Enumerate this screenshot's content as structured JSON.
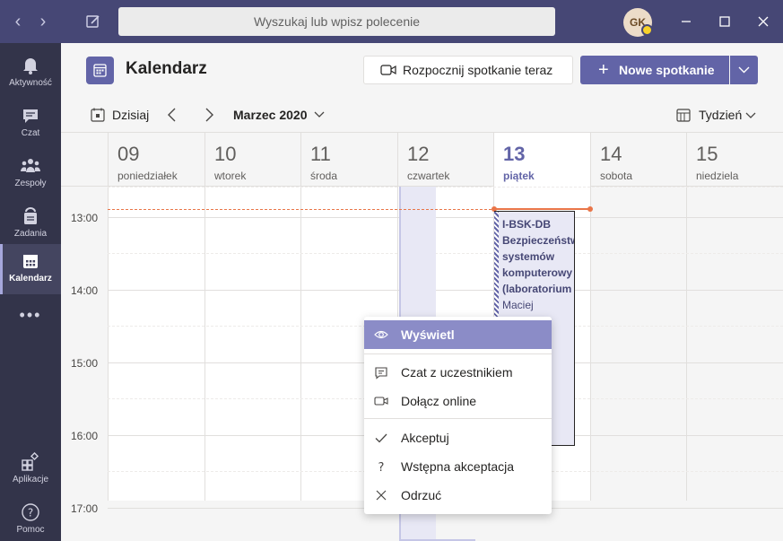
{
  "titlebar": {
    "search_placeholder": "Wyszukaj lub wpisz polecenie",
    "avatar_initials": "GK"
  },
  "rail": {
    "items": [
      {
        "label": "Aktywność",
        "icon": "bell-icon"
      },
      {
        "label": "Czat",
        "icon": "chat-icon"
      },
      {
        "label": "Zespoły",
        "icon": "teams-icon"
      },
      {
        "label": "Zadania",
        "icon": "assignments-icon"
      },
      {
        "label": "Kalendarz",
        "icon": "calendar-icon"
      },
      {
        "label": "Aplikacje",
        "icon": "apps-icon"
      },
      {
        "label": "Pomoc",
        "icon": "help-icon"
      }
    ],
    "more": "•••"
  },
  "header": {
    "title": "Kalendarz",
    "meet_now": "Rozpocznij spotkanie teraz",
    "new_meeting": "Nowe spotkanie"
  },
  "toolbar": {
    "today": "Dzisiaj",
    "month": "Marzec 2020",
    "view": "Tydzień"
  },
  "days": [
    {
      "num": "09",
      "name": "poniedziałek"
    },
    {
      "num": "10",
      "name": "wtorek"
    },
    {
      "num": "11",
      "name": "środa"
    },
    {
      "num": "12",
      "name": "czwartek"
    },
    {
      "num": "13",
      "name": "piątek"
    },
    {
      "num": "14",
      "name": "sobota"
    },
    {
      "num": "15",
      "name": "niedziela"
    }
  ],
  "times": [
    "13:00",
    "14:00",
    "15:00",
    "16:00",
    "17:00"
  ],
  "event": {
    "lines": [
      "I-BSK-DB",
      "Bezpieczeństw",
      "systemów",
      "komputerowy",
      "(laboratorium"
    ],
    "organizer": "Maciej"
  },
  "context_menu": {
    "items": [
      {
        "label": "Wyświetl",
        "icon": "eye-icon"
      },
      {
        "label": "Czat z uczestnikiem",
        "icon": "chat-icon"
      },
      {
        "label": "Dołącz online",
        "icon": "video-icon"
      },
      {
        "label": "Akceptuj",
        "icon": "check-icon"
      },
      {
        "label": "Wstępna akceptacja",
        "icon": "question-icon"
      },
      {
        "label": "Odrzuć",
        "icon": "x-icon"
      }
    ]
  },
  "colors": {
    "brand": "#6264a7",
    "titlebar": "#464775",
    "rail": "#33344a",
    "now_line": "#e97548"
  }
}
